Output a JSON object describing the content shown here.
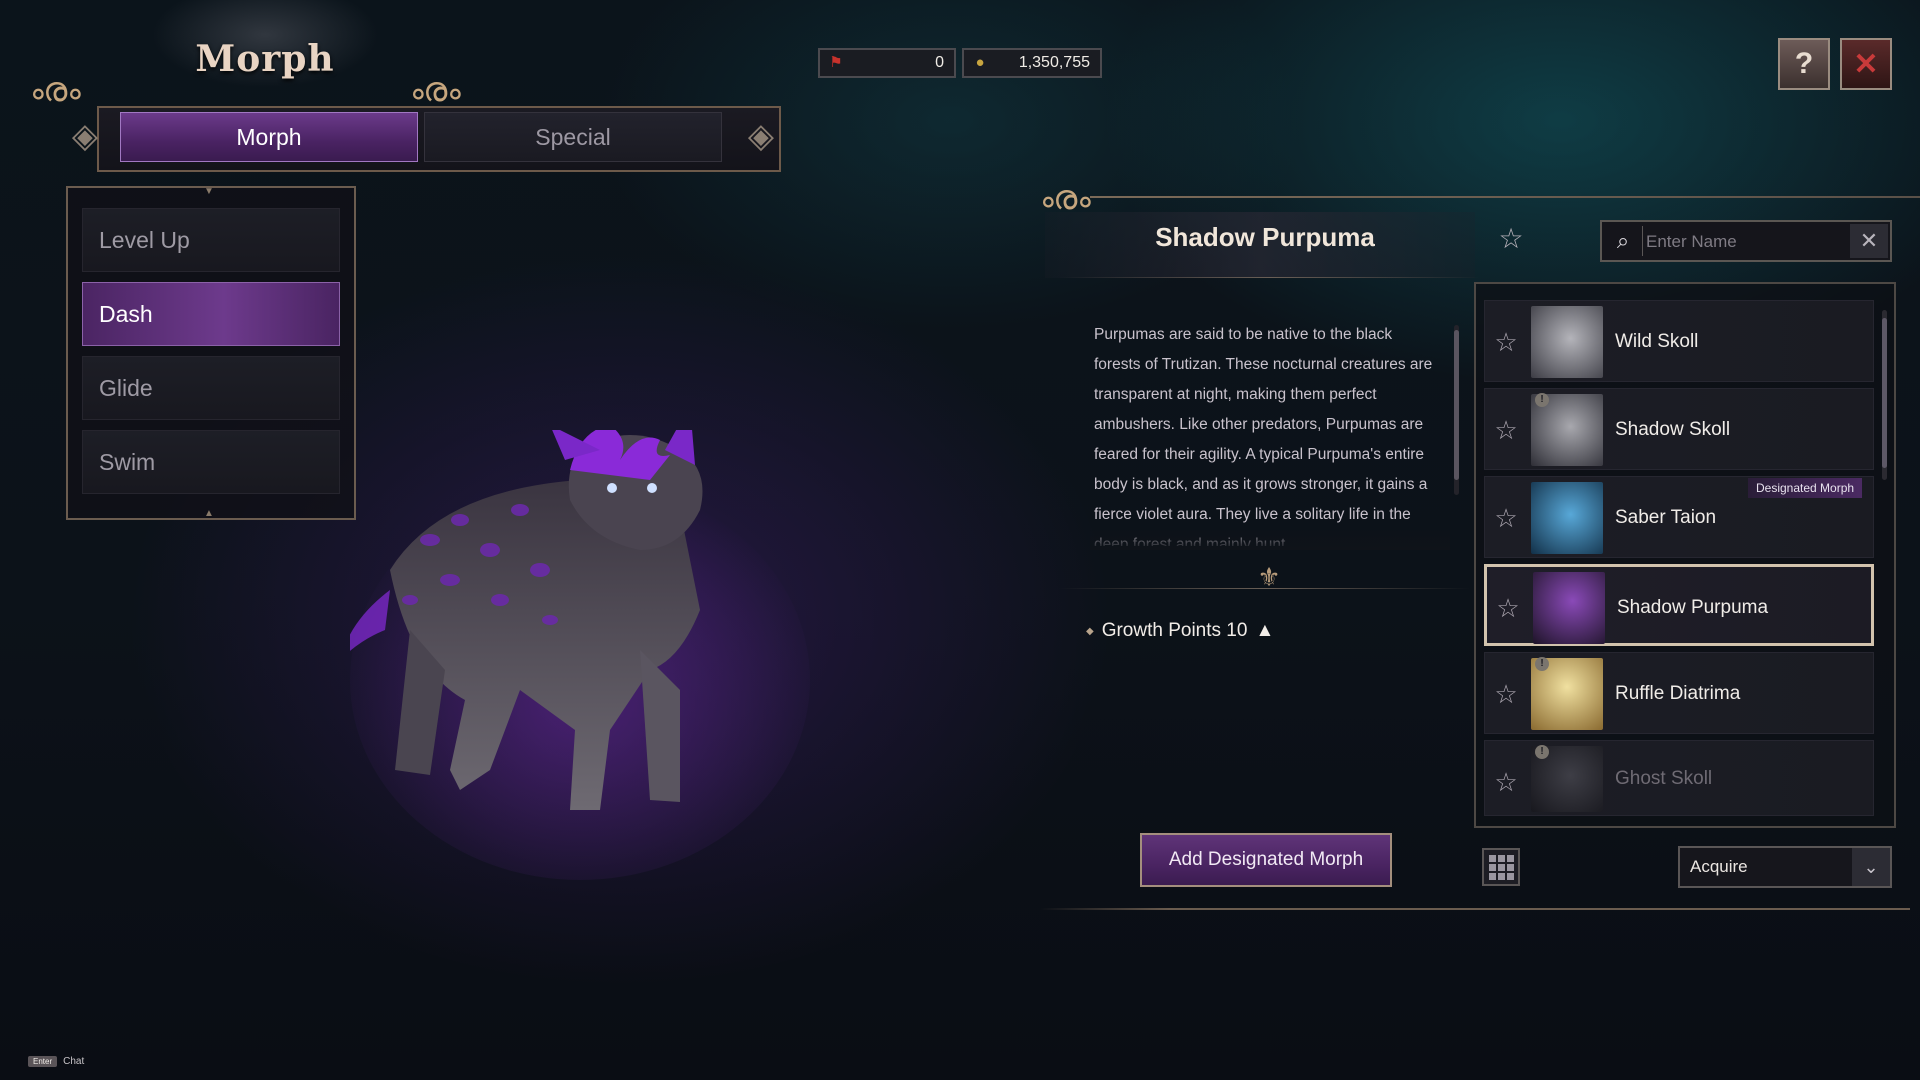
{
  "title": "Morph",
  "tabs": [
    {
      "label": "Morph",
      "active": true
    },
    {
      "label": "Special",
      "active": false
    }
  ],
  "currency": {
    "first_value": "0",
    "second_value": "1,350,755",
    "first_icon": "red-pennant-icon",
    "second_icon": "gold-coin-icon"
  },
  "side_menu": {
    "items": [
      {
        "label": "Level Up",
        "active": false
      },
      {
        "label": "Dash",
        "active": true
      },
      {
        "label": "Glide",
        "active": false
      },
      {
        "label": "Swim",
        "active": false
      }
    ]
  },
  "detail": {
    "name": "Shadow Purpuma",
    "description": "Purpumas are said to be native to the black forests of Trutizan. These nocturnal creatures are transparent at night, making them perfect ambushers. Like other predators, Purpumas are feared for their agility. A typical Purpuma's entire body is black, and as it grows stronger, it gains a fierce violet aura. They live a solitary life in the deep forest and mainly hunt",
    "growth_label": "Growth Points 10",
    "growth_icon": "up-triangle-icon",
    "designate_button": "Add Designated Morph"
  },
  "search": {
    "placeholder": "Enter Name",
    "value": ""
  },
  "morph_list": [
    {
      "name": "Wild Skoll",
      "locked": false,
      "selected": false,
      "owned": true,
      "thumb_color": "#9a9aa0"
    },
    {
      "name": "Shadow Skoll",
      "locked": true,
      "selected": false,
      "owned": true,
      "thumb_color": "#8a8a90"
    },
    {
      "name": "Saber Taion",
      "locked": false,
      "selected": false,
      "owned": true,
      "thumb_color": "#3a7aa8"
    },
    {
      "name": "Shadow Purpuma",
      "locked": false,
      "selected": true,
      "owned": true,
      "thumb_color": "#6a3a8a"
    },
    {
      "name": "Ruffle Diatrima",
      "locked": true,
      "selected": false,
      "owned": true,
      "thumb_color": "#d8c070"
    },
    {
      "name": "Ghost Skoll",
      "locked": true,
      "selected": false,
      "owned": false,
      "thumb_color": "#3a3a40"
    }
  ],
  "designated_badge": "Designated Morph",
  "filter_select": {
    "value": "Acquire"
  },
  "chat_hint": {
    "key": "Enter",
    "label": "Chat"
  },
  "colors": {
    "accent_purple": "#6b3a8a",
    "frame_gold": "#a48f7d",
    "close_red": "#c83a3a"
  }
}
